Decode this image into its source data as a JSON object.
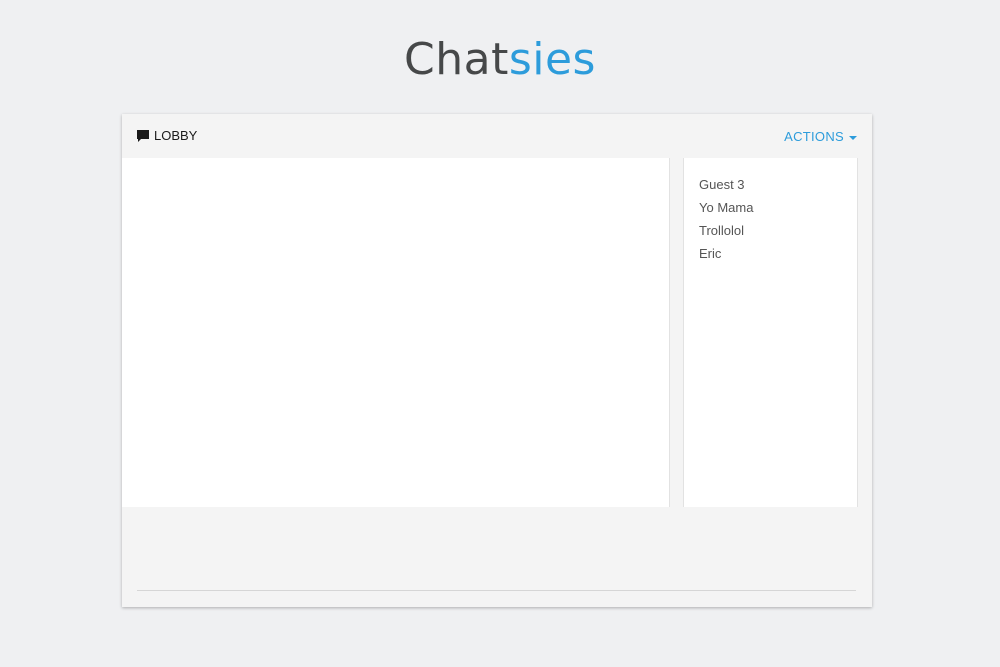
{
  "logo": {
    "part1": "Chat",
    "part2": "sies"
  },
  "header": {
    "room_name": "LOBBY",
    "room_icon": "chat-bubble-icon",
    "actions_label": "ACTIONS",
    "actions_icon": "caret-down-icon"
  },
  "users": [
    "Guest 3",
    "Yo Mama",
    "Trollolol",
    "Eric"
  ],
  "composer": {
    "input_value": "",
    "placeholder": ""
  },
  "colors": {
    "accent": "#2d9cdb",
    "background": "#eff0f2",
    "panel": "#f4f4f4"
  }
}
